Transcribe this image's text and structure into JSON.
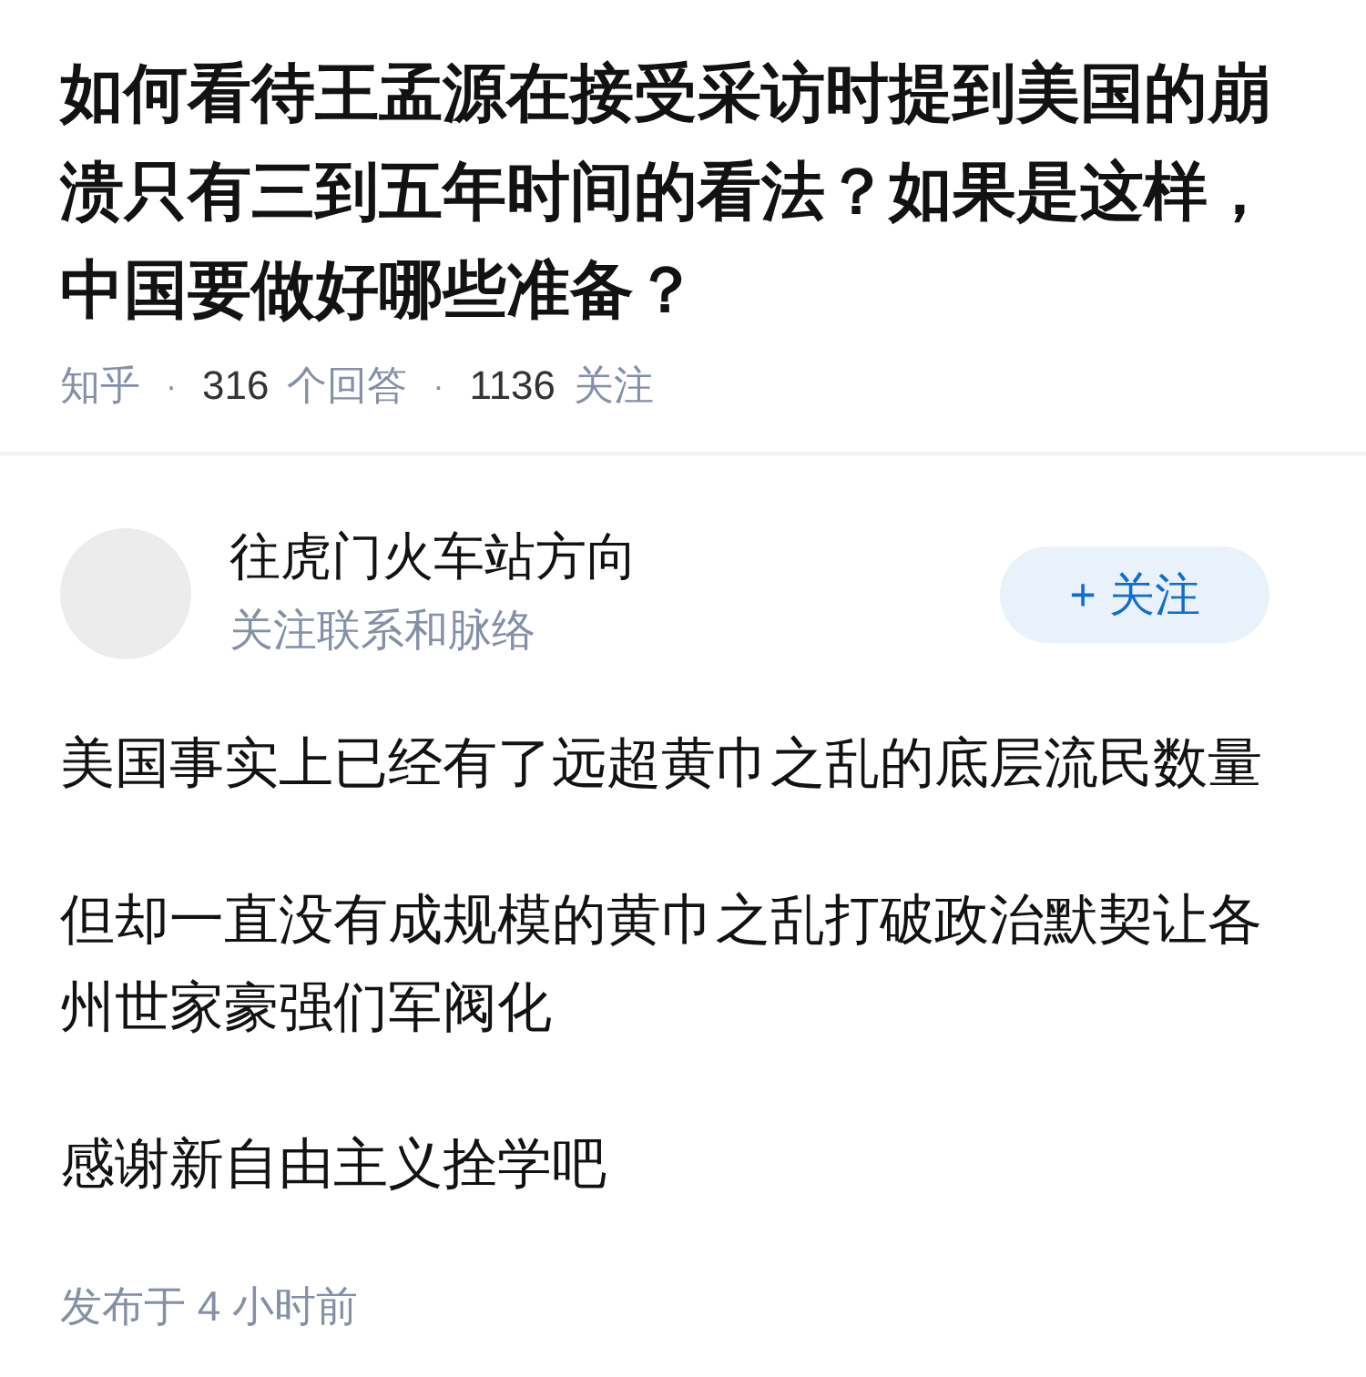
{
  "question": {
    "title": "如何看待王孟源在接受采访时提到美国的崩溃只有三到五年时间的看法？如果是这样，中国要做好哪些准备？",
    "meta": [
      {
        "kind": "source",
        "text": "知乎"
      },
      {
        "kind": "separator",
        "text": "·"
      },
      {
        "kind": "count",
        "number": "316",
        "label": "个回答"
      },
      {
        "kind": "separator",
        "text": "·"
      },
      {
        "kind": "count",
        "number": "1136",
        "label": "关注"
      }
    ]
  },
  "answer": {
    "author": {
      "name": "往虎门火车站方向",
      "headline": "关注联系和脉络"
    },
    "follow_button": {
      "label": "+ 关注"
    },
    "paragraphs": [
      "美国事实上已经有了远超黄巾之乱的底层流民数量",
      "但却一直没有成规模的黄巾之乱打破政治默契让各州世家豪强们军阀化",
      "感谢新自由主义拴学吧"
    ],
    "published": "发布于 4 小时前"
  }
}
